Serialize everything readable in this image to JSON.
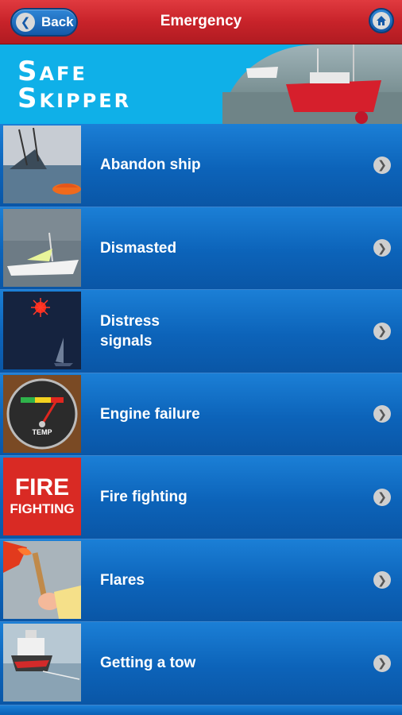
{
  "header": {
    "back_label": "Back",
    "title": "Emergency"
  },
  "banner": {
    "logo_line1": "Safe",
    "logo_line2": "Skipper"
  },
  "items": [
    {
      "label": "Abandon ship",
      "icon": "abandon-ship-image"
    },
    {
      "label": "Dismasted",
      "icon": "dismasted-image"
    },
    {
      "label": "Distress signals",
      "icon": "distress-signals-image"
    },
    {
      "label": "Engine failure",
      "icon": "engine-gauge-image",
      "gauge_text": "TEMP"
    },
    {
      "label": "Fire fighting",
      "icon": "fire-fighting-image",
      "thumb_text1": "FIRE",
      "thumb_text2": "FIGHTING"
    },
    {
      "label": "Flares",
      "icon": "flare-image"
    },
    {
      "label": "Getting a tow",
      "icon": "tow-image"
    }
  ]
}
